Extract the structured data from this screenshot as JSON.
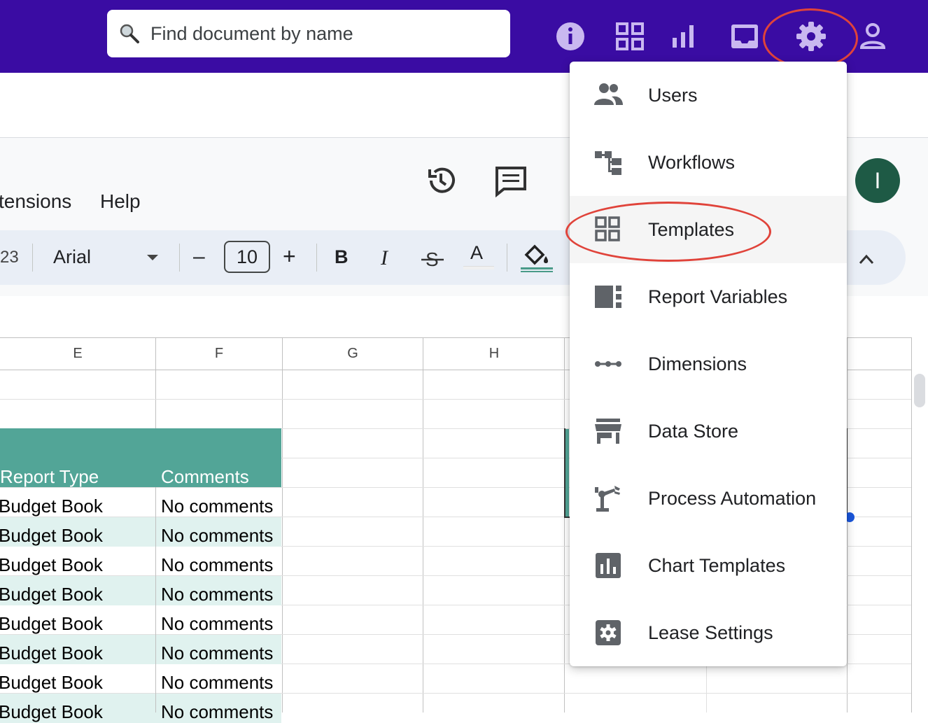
{
  "search": {
    "placeholder": "Find document by name"
  },
  "topbar_icons": [
    "info-icon",
    "grid-icon",
    "bar-chart-icon",
    "inbox-icon",
    "gear-icon",
    "person-icon"
  ],
  "appbar": {
    "menus": [
      "tensions",
      "Help"
    ],
    "avatar_initial": "I"
  },
  "toolbar": {
    "number_format_fragment": "23",
    "font": "Arial",
    "font_size": "10",
    "minus": "–",
    "plus": "+",
    "bold": "B",
    "italic": "I",
    "text_color": "A"
  },
  "grid": {
    "columns": [
      "E",
      "F",
      "G",
      "H"
    ],
    "header": {
      "report_type": "Report Type",
      "comments": "Comments"
    },
    "rows": [
      {
        "type": "Budget Book",
        "comment": "No comments"
      },
      {
        "type": "Budget Book",
        "comment": "No comments"
      },
      {
        "type": "Budget Book",
        "comment": "No comments"
      },
      {
        "type": "Budget Book",
        "comment": "No comments"
      },
      {
        "type": "Budget Book",
        "comment": "No comments"
      },
      {
        "type": "Budget Book",
        "comment": "No comments"
      },
      {
        "type": "Budget Book",
        "comment": "No comments"
      },
      {
        "type": "Budget Book",
        "comment": "No comments"
      }
    ]
  },
  "dropdown": {
    "items": [
      {
        "label": "Users",
        "icon": "users-icon"
      },
      {
        "label": "Workflows",
        "icon": "workflow-icon"
      },
      {
        "label": "Templates",
        "icon": "templates-icon",
        "active": true
      },
      {
        "label": "Report Variables",
        "icon": "report-variables-icon"
      },
      {
        "label": "Dimensions",
        "icon": "dimensions-icon"
      },
      {
        "label": "Data Store",
        "icon": "store-icon"
      },
      {
        "label": "Process Automation",
        "icon": "robot-arm-icon"
      },
      {
        "label": "Chart Templates",
        "icon": "chart-icon"
      },
      {
        "label": "Lease Settings",
        "icon": "settings-icon"
      }
    ]
  },
  "colors": {
    "topbar": "#3a0ca3",
    "highlight_ring": "#e0433a",
    "table_header": "#52a597",
    "band": "#e0f2ef",
    "avatar": "#1e5a45"
  }
}
